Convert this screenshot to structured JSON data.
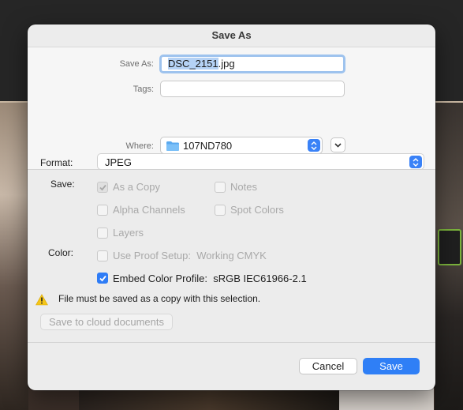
{
  "dialog": {
    "title": "Save As"
  },
  "save_as": {
    "label": "Save As:",
    "filename_selected": "DSC_2151",
    "filename_ext": ".jpg"
  },
  "tags": {
    "label": "Tags:",
    "value": ""
  },
  "where": {
    "label": "Where:",
    "folder": "107ND780"
  },
  "format": {
    "label": "Format:",
    "value": "JPEG"
  },
  "save_options": {
    "label": "Save:",
    "as_a_copy": "As a Copy",
    "notes": "Notes",
    "alpha_channels": "Alpha Channels",
    "spot_colors": "Spot Colors",
    "layers": "Layers"
  },
  "color_options": {
    "label": "Color:",
    "use_proof_setup": "Use Proof Setup:",
    "proof_profile": "Working CMYK",
    "embed_color_profile": "Embed Color Profile:",
    "embed_profile_value": "sRGB IEC61966-2.1"
  },
  "warning": {
    "text": "File must be saved as a copy with this selection."
  },
  "buttons": {
    "cloud": "Save to cloud documents",
    "cancel": "Cancel",
    "save": "Save"
  },
  "colors": {
    "accent": "#2f7ff6",
    "warning": "#f5c518"
  }
}
